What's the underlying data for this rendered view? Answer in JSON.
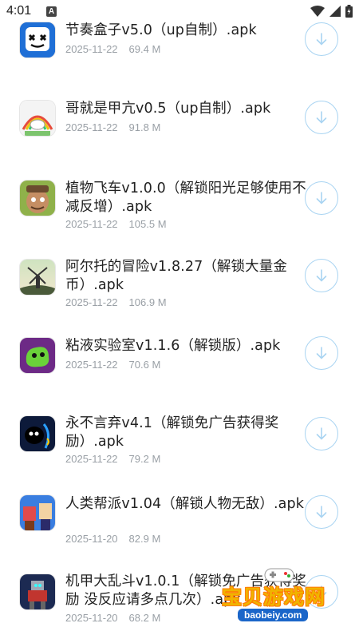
{
  "status_bar": {
    "time": "4:01",
    "notif_badge": "A",
    "icons": [
      "wifi-icon",
      "signal-icon",
      "battery-icon"
    ]
  },
  "items": [
    {
      "title": "节奏盒子v5.0（up自制）.apk",
      "date": "2025-11-22",
      "size": "69.4 M",
      "icon": "marshmello-mask-icon"
    },
    {
      "title": "哥就是甲亢v0.5（up自制）.apk",
      "date": "2025-11-22",
      "size": "91.8 M",
      "icon": "unicorn-rainbow-icon"
    },
    {
      "title": "植物飞车v1.0.0（解锁阳光足够使用不减反增）.apk",
      "date": "2025-11-22",
      "size": "105.5 M",
      "icon": "zombie-face-icon"
    },
    {
      "title": "阿尔托的冒险v1.8.27（解锁大量金币）.apk",
      "date": "2025-11-22",
      "size": "106.9 M",
      "icon": "windmill-icon"
    },
    {
      "title": "粘液实验室v1.1.6（解锁版）.apk",
      "date": "2025-11-22",
      "size": "70.6 M",
      "icon": "slime-icon"
    },
    {
      "title": "永不言弃v4.1（解锁免广告获得奖励）.apk",
      "date": "2025-11-22",
      "size": "79.2 M",
      "icon": "black-blob-icon"
    },
    {
      "title": "人类帮派v1.04（解锁人物无敌）.apk",
      "date": "2025-11-20",
      "size": "82.9 M",
      "icon": "blocky-characters-icon"
    },
    {
      "title": "机甲大乱斗v1.0.1（解锁免广告获得奖励 没反应请多点几次）.apk",
      "date": "2025-11-20",
      "size": "68.2 M",
      "icon": "mech-robot-icon"
    }
  ],
  "watermark": {
    "text": "宝贝游戏网",
    "url": "baobeiy.com"
  },
  "colors": {
    "download_ring": "#a9d4f2",
    "meta_text": "#9aa0a6",
    "title_text": "#222222"
  }
}
